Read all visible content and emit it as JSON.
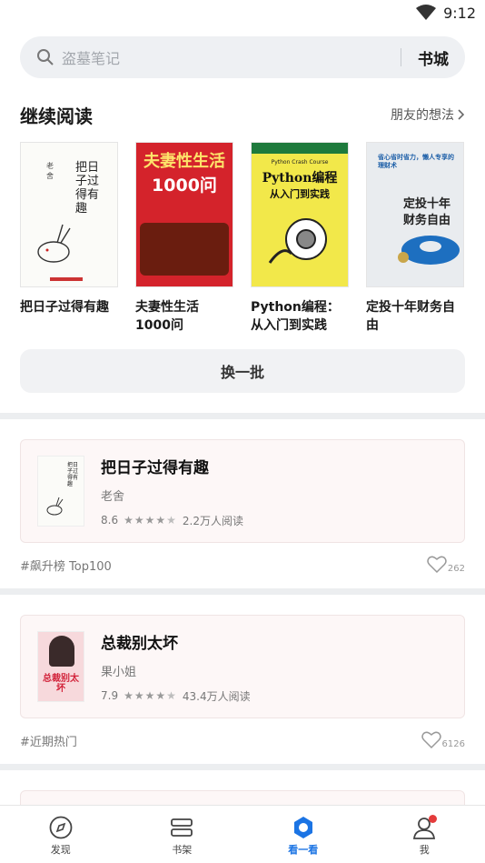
{
  "status": {
    "time": "9:12"
  },
  "search": {
    "placeholder": "盗墓笔记",
    "store_label": "书城"
  },
  "continue_reading": {
    "title": "继续阅读",
    "more_label": "朋友的想法",
    "books": [
      {
        "title": "把日子过得有趣",
        "cover_text": "把日子过得有趣",
        "cover_author": "老舍"
      },
      {
        "title": "夫妻性生活1000问",
        "cover_text": "夫妻性生活",
        "cover_sub": "1000问"
      },
      {
        "title": "Python编程：从入门到实践",
        "cover_text": "Python编程",
        "cover_sub": "从入门到实践",
        "cover_top": "Python Crash Course"
      },
      {
        "title": "定投十年财务自由",
        "cover_text": "定投十年",
        "cover_sub": "财务自由",
        "cover_top": "省心省时省力，懒人专享的理财术"
      }
    ],
    "refresh_label": "换一批"
  },
  "feed": [
    {
      "name": "把日子过得有趣",
      "author": "老舍",
      "score": "8.6",
      "stars": 4,
      "reads": "2.2万人阅读",
      "tag": "#飙升榜 Top100",
      "likes": "262"
    },
    {
      "name": "总裁别太坏",
      "author": "果小姐",
      "score": "7.9",
      "stars": 4,
      "reads": "43.4万人阅读",
      "tag": "#近期热门",
      "likes": "6126",
      "thumb_text": "总裁别太坏"
    }
  ],
  "tabs": [
    {
      "label": "发现",
      "icon": "compass-icon"
    },
    {
      "label": "书架",
      "icon": "bookshelf-icon"
    },
    {
      "label": "看一看",
      "icon": "look-icon"
    },
    {
      "label": "我",
      "icon": "profile-icon"
    }
  ],
  "colors": {
    "accent": "#1b74e4",
    "badge": "#e43b3b"
  }
}
